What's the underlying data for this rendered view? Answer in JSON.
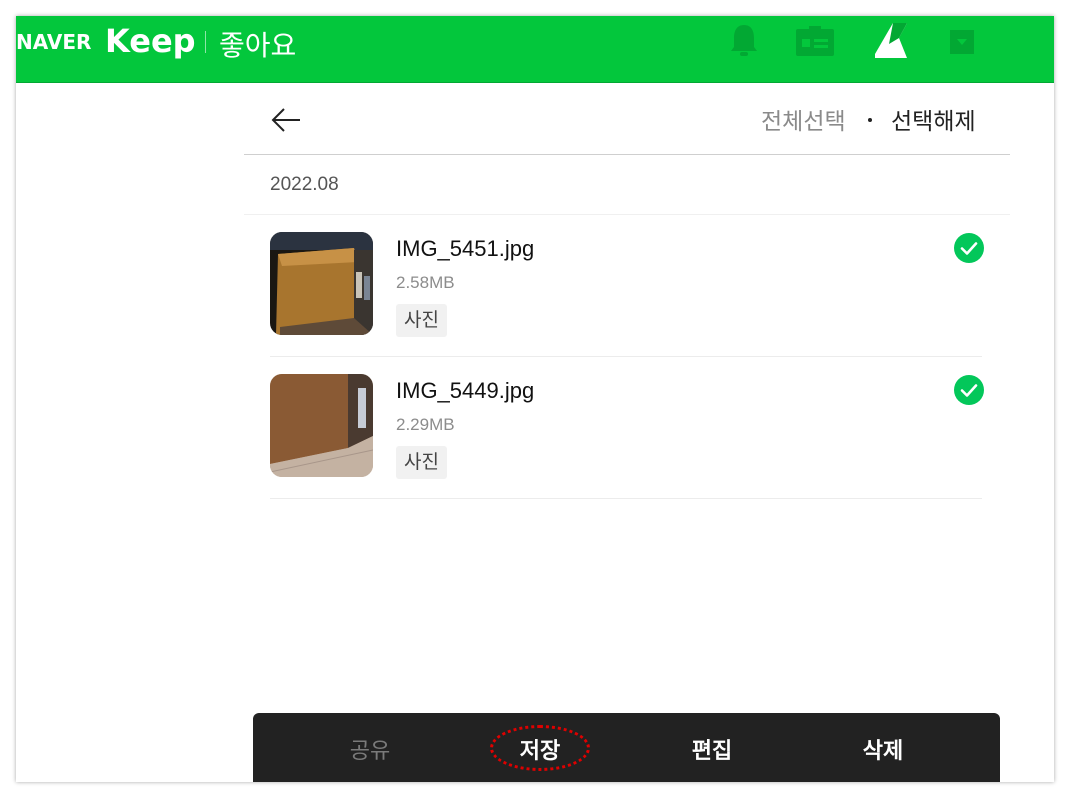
{
  "header": {
    "brand_naver": "NAVER",
    "brand_keep": "Keep",
    "folder_title": "좋아요",
    "icons": [
      "bell-icon",
      "id-card-icon",
      "naver-app-icon",
      "dropdown-icon"
    ],
    "accent_color": "#03c73c"
  },
  "toolbar": {
    "select_all": "전체선택",
    "deselect": "선택해제"
  },
  "date_group": "2022.08",
  "files": [
    {
      "name": "IMG_5451.jpg",
      "size": "2.58MB",
      "tag": "사진",
      "selected": true
    },
    {
      "name": "IMG_5449.jpg",
      "size": "2.29MB",
      "tag": "사진",
      "selected": true
    }
  ],
  "actions": {
    "share": "공유",
    "save": "저장",
    "edit": "편집",
    "delete": "삭제"
  },
  "colors": {
    "check_green": "#03c75a",
    "action_bar": "#222222",
    "highlight_red": "#e00000"
  }
}
